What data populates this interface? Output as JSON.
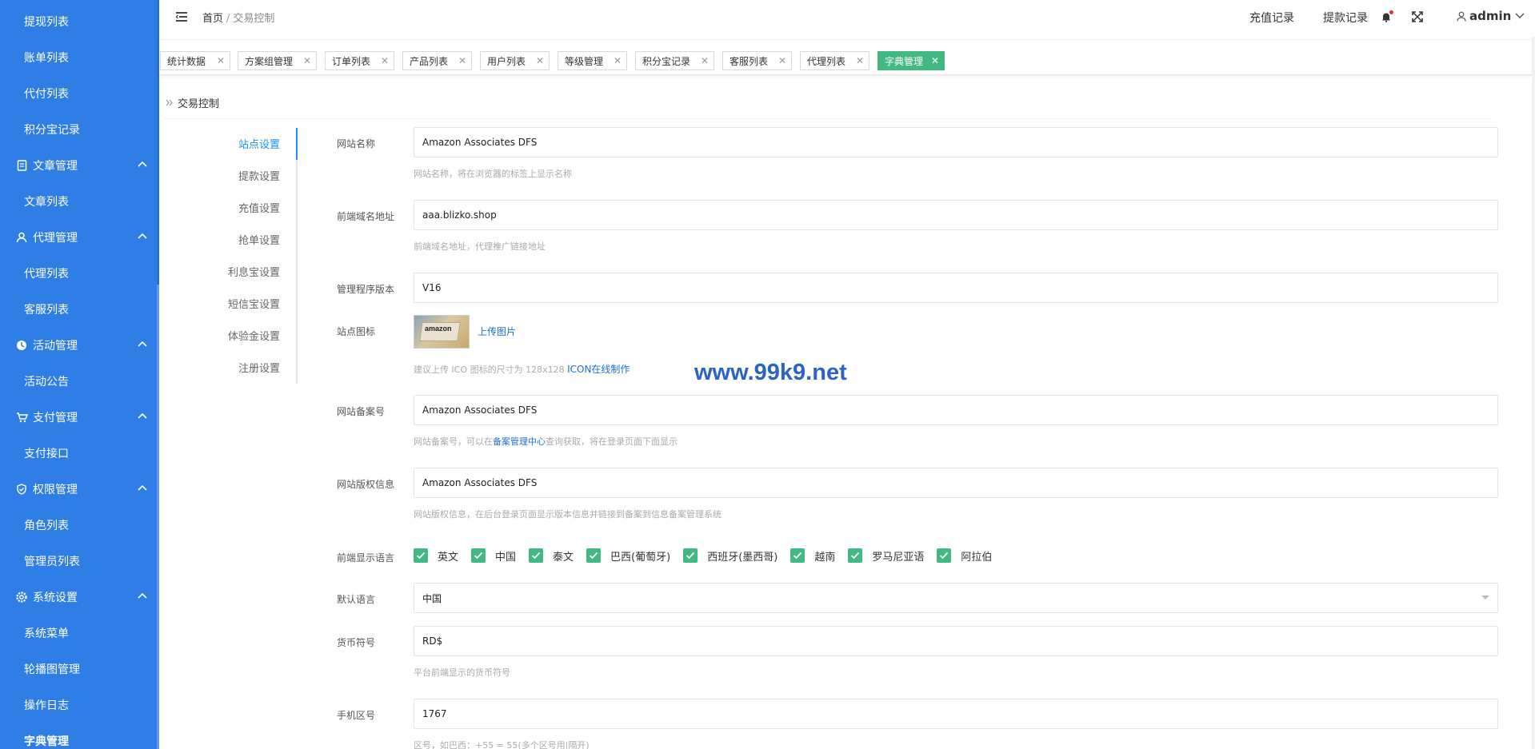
{
  "sidebar": {
    "items": [
      {
        "label": "提现列表"
      },
      {
        "label": "账单列表"
      },
      {
        "label": "代付列表"
      },
      {
        "label": "积分宝记录"
      },
      {
        "label": "文章管理"
      },
      {
        "label": "文章列表"
      },
      {
        "label": "代理管理"
      },
      {
        "label": "代理列表"
      },
      {
        "label": "客服列表"
      },
      {
        "label": "活动管理"
      },
      {
        "label": "活动公告"
      },
      {
        "label": "支付管理"
      },
      {
        "label": "支付接口"
      },
      {
        "label": "权限管理"
      },
      {
        "label": "角色列表"
      },
      {
        "label": "管理员列表"
      },
      {
        "label": "系统设置"
      },
      {
        "label": "系统菜单"
      },
      {
        "label": "轮播图管理"
      },
      {
        "label": "操作日志"
      },
      {
        "label": "字典管理"
      }
    ]
  },
  "header": {
    "breadcrumb_home": "首页",
    "breadcrumb_sep": "/",
    "breadcrumb_current": "交易控制",
    "recharge_link": "充值记录",
    "withdraw_link": "提款记录",
    "username": "admin"
  },
  "tabs": [
    {
      "label": "统计数据"
    },
    {
      "label": "方案组管理"
    },
    {
      "label": "订单列表"
    },
    {
      "label": "产品列表"
    },
    {
      "label": "用户列表"
    },
    {
      "label": "等级管理"
    },
    {
      "label": "积分宝记录"
    },
    {
      "label": "客服列表"
    },
    {
      "label": "代理列表"
    },
    {
      "label": "字典管理"
    }
  ],
  "page": {
    "title": "交易控制"
  },
  "settings_tabs": [
    {
      "label": "站点设置"
    },
    {
      "label": "提款设置"
    },
    {
      "label": "充值设置"
    },
    {
      "label": "抢单设置"
    },
    {
      "label": "利息宝设置"
    },
    {
      "label": "短信宝设置"
    },
    {
      "label": "体验金设置"
    },
    {
      "label": "注册设置"
    }
  ],
  "form": {
    "site_name": {
      "label": "网站名称",
      "value": "Amazon Associates DFS",
      "help": "网站名称，将在浏览器的标签上显示名称"
    },
    "frontend_domain": {
      "label": "前端域名地址",
      "value": "aaa.blizko.shop",
      "help": "前端域名地址，代理推广链接地址"
    },
    "program_version": {
      "label": "管理程序版本",
      "value": "V16"
    },
    "site_icon": {
      "label": "站点图标",
      "upload": "上传图片",
      "icon_text": "amazon",
      "help_prefix": "建议上传 ICO 图标的尺寸为 128x128 ",
      "help_link": "ICON在线制作"
    },
    "icp": {
      "label": "网站备案号",
      "value": "Amazon Associates DFS",
      "help_prefix": "网站备案号，可以在",
      "help_link": "备案管理中心",
      "help_suffix": "查询获取，将在登录页面下面显示"
    },
    "copyright": {
      "label": "网站版权信息",
      "value": "Amazon Associates DFS",
      "help": "网站版权信息，在后台登录页面显示版本信息并链接到备案到信息备案管理系统"
    },
    "languages": {
      "label": "前端显示语言",
      "options": [
        {
          "label": "英文",
          "checked": true
        },
        {
          "label": "中国",
          "checked": true
        },
        {
          "label": "泰文",
          "checked": true
        },
        {
          "label": "巴西(葡萄牙)",
          "checked": true
        },
        {
          "label": "西班牙(墨西哥)",
          "checked": true
        },
        {
          "label": "越南",
          "checked": true
        },
        {
          "label": "罗马尼亚语",
          "checked": true
        },
        {
          "label": "阿拉伯",
          "checked": true
        }
      ]
    },
    "default_language": {
      "label": "默认语言",
      "value": "中国"
    },
    "currency": {
      "label": "货币符号",
      "value": "RD$",
      "help": "平台前端显示的货币符号"
    },
    "phone_code": {
      "label": "手机区号",
      "value": "1767",
      "help": "区号，如巴西：+55 = 55(多个区号用|隔开)"
    }
  },
  "watermark": "www.99k9.net",
  "colors": {
    "sidebar_bg": "#2f7ee6",
    "active_tab": "#42b983",
    "link": "#1b6fd6",
    "accent": "#1890ff"
  }
}
